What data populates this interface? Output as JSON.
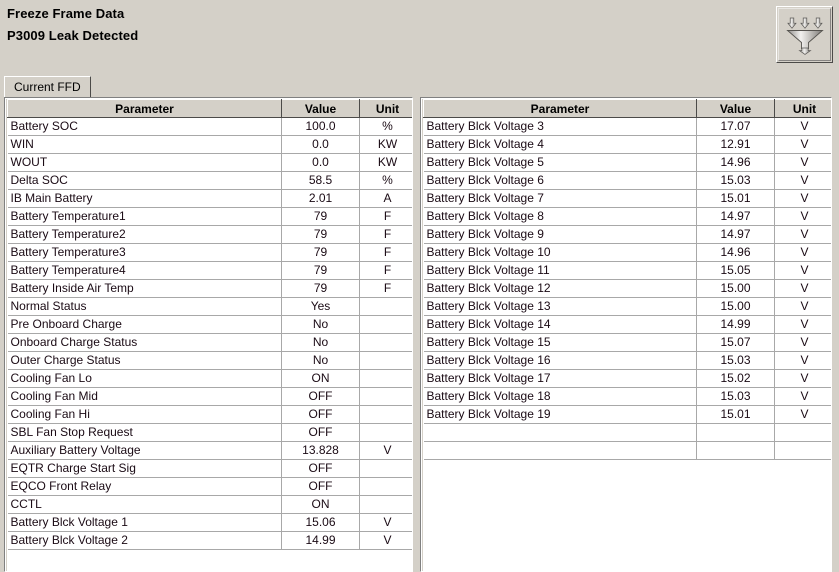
{
  "window": {
    "title": "Freeze Frame Data",
    "dtc_line": "P3009 Leak Detected"
  },
  "toolbar": {
    "filter_button_name": "filter-funnel-button",
    "filter_icon": "funnel-filter-icon"
  },
  "tabs": [
    {
      "label": "Current FFD",
      "selected": true
    }
  ],
  "colors": {
    "window_background": "#d4d0c8",
    "grid_background": "#ffffff",
    "grid_line": "#a8a8a8",
    "header_background": "#d4d0c8",
    "text": "#000000"
  },
  "grids": {
    "left": {
      "columns": [
        "Parameter",
        "Value",
        "Unit"
      ],
      "rows": [
        {
          "parameter": "Battery SOC",
          "value": "100.0",
          "unit": "%"
        },
        {
          "parameter": "WIN",
          "value": "0.0",
          "unit": "KW"
        },
        {
          "parameter": "WOUT",
          "value": "0.0",
          "unit": "KW"
        },
        {
          "parameter": "Delta SOC",
          "value": "58.5",
          "unit": "%"
        },
        {
          "parameter": "IB Main Battery",
          "value": "2.01",
          "unit": "A"
        },
        {
          "parameter": "Battery Temperature1",
          "value": "79",
          "unit": "F"
        },
        {
          "parameter": "Battery Temperature2",
          "value": "79",
          "unit": "F"
        },
        {
          "parameter": "Battery Temperature3",
          "value": "79",
          "unit": "F"
        },
        {
          "parameter": "Battery Temperature4",
          "value": "79",
          "unit": "F"
        },
        {
          "parameter": "Battery Inside Air Temp",
          "value": "79",
          "unit": "F"
        },
        {
          "parameter": "Normal Status",
          "value": "Yes",
          "unit": ""
        },
        {
          "parameter": "Pre Onboard Charge",
          "value": "No",
          "unit": ""
        },
        {
          "parameter": "Onboard Charge Status",
          "value": "No",
          "unit": ""
        },
        {
          "parameter": "Outer Charge Status",
          "value": "No",
          "unit": ""
        },
        {
          "parameter": "Cooling Fan Lo",
          "value": "ON",
          "unit": ""
        },
        {
          "parameter": "Cooling Fan Mid",
          "value": "OFF",
          "unit": ""
        },
        {
          "parameter": "Cooling Fan Hi",
          "value": "OFF",
          "unit": ""
        },
        {
          "parameter": "SBL Fan Stop Request",
          "value": "OFF",
          "unit": ""
        },
        {
          "parameter": "Auxiliary Battery Voltage",
          "value": "13.828",
          "unit": "V"
        },
        {
          "parameter": "EQTR Charge Start Sig",
          "value": "OFF",
          "unit": ""
        },
        {
          "parameter": "EQCO Front Relay",
          "value": "OFF",
          "unit": ""
        },
        {
          "parameter": "CCTL",
          "value": "ON",
          "unit": ""
        },
        {
          "parameter": "Battery Blck Voltage 1",
          "value": "15.06",
          "unit": "V"
        },
        {
          "parameter": "Battery Blck Voltage 2",
          "value": "14.99",
          "unit": "V"
        }
      ]
    },
    "right": {
      "columns": [
        "Parameter",
        "Value",
        "Unit"
      ],
      "rows": [
        {
          "parameter": "Battery Blck Voltage 3",
          "value": "17.07",
          "unit": "V"
        },
        {
          "parameter": "Battery Blck Voltage 4",
          "value": "12.91",
          "unit": "V"
        },
        {
          "parameter": "Battery Blck Voltage 5",
          "value": "14.96",
          "unit": "V"
        },
        {
          "parameter": "Battery Blck Voltage 6",
          "value": "15.03",
          "unit": "V"
        },
        {
          "parameter": "Battery Blck Voltage 7",
          "value": "15.01",
          "unit": "V"
        },
        {
          "parameter": "Battery Blck Voltage 8",
          "value": "14.97",
          "unit": "V"
        },
        {
          "parameter": "Battery Blck Voltage 9",
          "value": "14.97",
          "unit": "V"
        },
        {
          "parameter": "Battery Blck Voltage 10",
          "value": "14.96",
          "unit": "V"
        },
        {
          "parameter": "Battery Blck Voltage 11",
          "value": "15.05",
          "unit": "V"
        },
        {
          "parameter": "Battery Blck Voltage 12",
          "value": "15.00",
          "unit": "V"
        },
        {
          "parameter": "Battery Blck Voltage 13",
          "value": "15.00",
          "unit": "V"
        },
        {
          "parameter": "Battery Blck Voltage 14",
          "value": "14.99",
          "unit": "V"
        },
        {
          "parameter": "Battery Blck Voltage 15",
          "value": "15.07",
          "unit": "V"
        },
        {
          "parameter": "Battery Blck Voltage 16",
          "value": "15.03",
          "unit": "V"
        },
        {
          "parameter": "Battery Blck Voltage 17",
          "value": "15.02",
          "unit": "V"
        },
        {
          "parameter": "Battery Blck Voltage 18",
          "value": "15.03",
          "unit": "V"
        },
        {
          "parameter": "Battery Blck Voltage 19",
          "value": "15.01",
          "unit": "V"
        },
        {
          "parameter": "",
          "value": "",
          "unit": ""
        },
        {
          "parameter": "",
          "value": "",
          "unit": ""
        }
      ]
    }
  }
}
